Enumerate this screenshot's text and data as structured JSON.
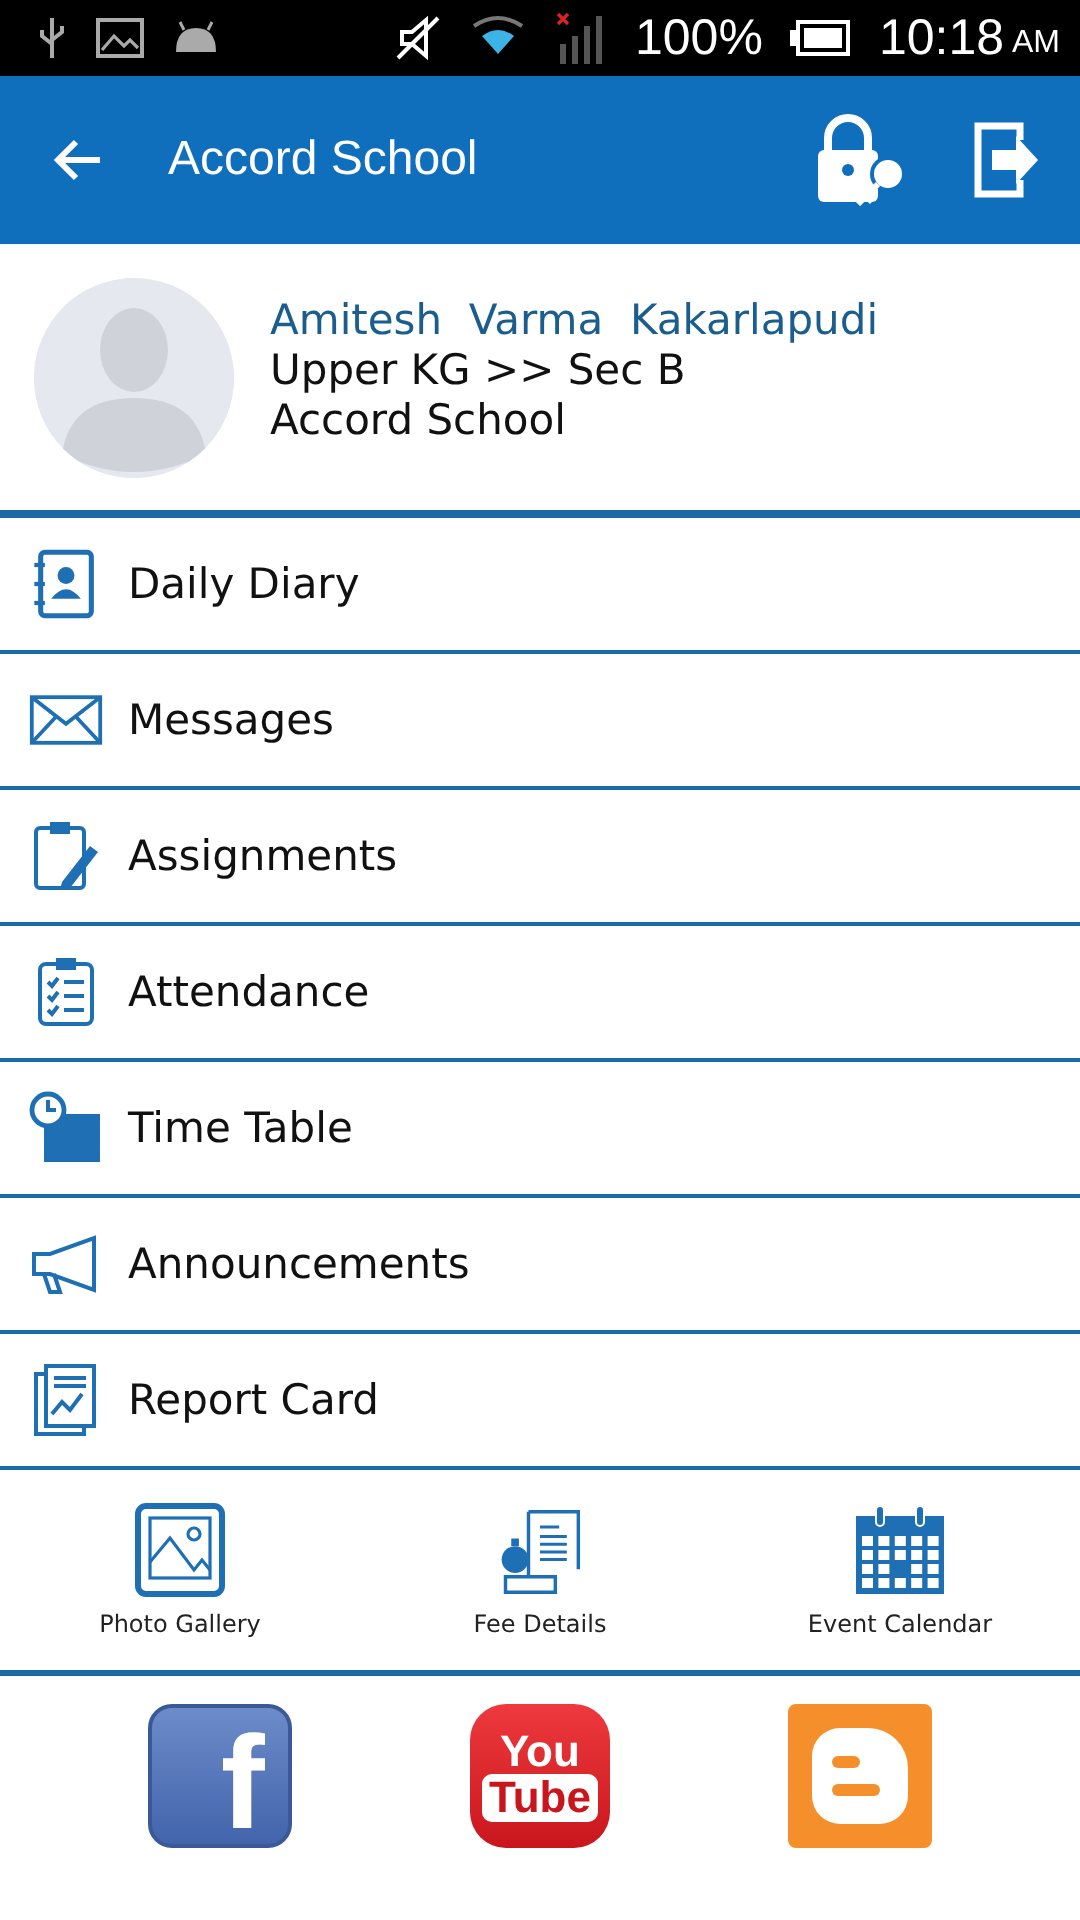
{
  "status_bar": {
    "battery": "100%",
    "time": "10:18",
    "ampm": "AM"
  },
  "app_bar": {
    "title": "Accord School"
  },
  "profile": {
    "name": "Amitesh  Varma  Kakarlapudi",
    "class": "Upper KG >> Sec B",
    "school": "Accord School"
  },
  "menu": [
    {
      "kind": "diary",
      "label": "Daily Diary"
    },
    {
      "kind": "messages",
      "label": "Messages"
    },
    {
      "kind": "assignments",
      "label": "Assignments"
    },
    {
      "kind": "attendance",
      "label": "Attendance"
    },
    {
      "kind": "timetable",
      "label": "Time Table"
    },
    {
      "kind": "announcements",
      "label": "Announcements"
    },
    {
      "kind": "reportcard",
      "label": "Report Card"
    }
  ],
  "quick_links": [
    {
      "kind": "gallery",
      "label": "Photo Gallery"
    },
    {
      "kind": "fee",
      "label": "Fee Details"
    },
    {
      "kind": "calendar",
      "label": "Event Calendar"
    }
  ],
  "social": [
    {
      "kind": "facebook",
      "glyph": "f"
    },
    {
      "kind": "youtube",
      "top": "You",
      "bottom": "Tube"
    },
    {
      "kind": "blogger"
    }
  ]
}
